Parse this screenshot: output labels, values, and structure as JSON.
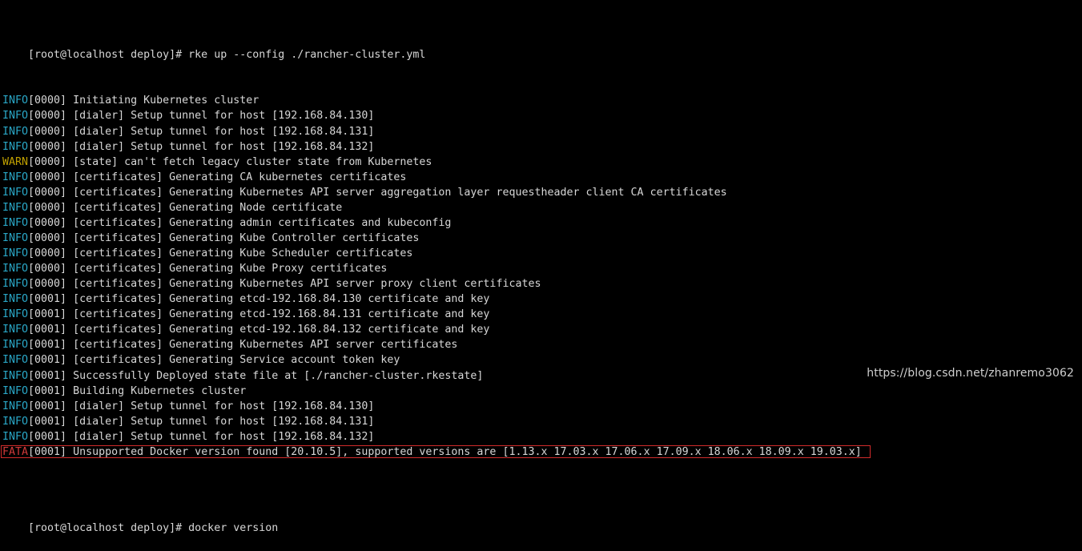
{
  "terminal": {
    "prompt_line": "[root@localhost deploy]# rke up --config ./rancher-cluster.yml",
    "log_lines": [
      {
        "level": "INFO",
        "code": "[0000]",
        "message": " Initiating Kubernetes cluster"
      },
      {
        "level": "INFO",
        "code": "[0000]",
        "message": " [dialer] Setup tunnel for host [192.168.84.130]"
      },
      {
        "level": "INFO",
        "code": "[0000]",
        "message": " [dialer] Setup tunnel for host [192.168.84.131]"
      },
      {
        "level": "INFO",
        "code": "[0000]",
        "message": " [dialer] Setup tunnel for host [192.168.84.132]"
      },
      {
        "level": "WARN",
        "code": "[0000]",
        "message": " [state] can't fetch legacy cluster state from Kubernetes"
      },
      {
        "level": "INFO",
        "code": "[0000]",
        "message": " [certificates] Generating CA kubernetes certificates"
      },
      {
        "level": "INFO",
        "code": "[0000]",
        "message": " [certificates] Generating Kubernetes API server aggregation layer requestheader client CA certificates"
      },
      {
        "level": "INFO",
        "code": "[0000]",
        "message": " [certificates] Generating Node certificate"
      },
      {
        "level": "INFO",
        "code": "[0000]",
        "message": " [certificates] Generating admin certificates and kubeconfig"
      },
      {
        "level": "INFO",
        "code": "[0000]",
        "message": " [certificates] Generating Kube Controller certificates"
      },
      {
        "level": "INFO",
        "code": "[0000]",
        "message": " [certificates] Generating Kube Scheduler certificates"
      },
      {
        "level": "INFO",
        "code": "[0000]",
        "message": " [certificates] Generating Kube Proxy certificates"
      },
      {
        "level": "INFO",
        "code": "[0000]",
        "message": " [certificates] Generating Kubernetes API server proxy client certificates"
      },
      {
        "level": "INFO",
        "code": "[0001]",
        "message": " [certificates] Generating etcd-192.168.84.130 certificate and key"
      },
      {
        "level": "INFO",
        "code": "[0001]",
        "message": " [certificates] Generating etcd-192.168.84.131 certificate and key"
      },
      {
        "level": "INFO",
        "code": "[0001]",
        "message": " [certificates] Generating etcd-192.168.84.132 certificate and key"
      },
      {
        "level": "INFO",
        "code": "[0001]",
        "message": " [certificates] Generating Kubernetes API server certificates"
      },
      {
        "level": "INFO",
        "code": "[0001]",
        "message": " [certificates] Generating Service account token key"
      },
      {
        "level": "INFO",
        "code": "[0001]",
        "message": " Successfully Deployed state file at [./rancher-cluster.rkestate]"
      },
      {
        "level": "INFO",
        "code": "[0001]",
        "message": " Building Kubernetes cluster"
      },
      {
        "level": "INFO",
        "code": "[0001]",
        "message": " [dialer] Setup tunnel for host [192.168.84.130]"
      },
      {
        "level": "INFO",
        "code": "[0001]",
        "message": " [dialer] Setup tunnel for host [192.168.84.131]"
      },
      {
        "level": "INFO",
        "code": "[0001]",
        "message": " [dialer] Setup tunnel for host [192.168.84.132]"
      },
      {
        "level": "FATA",
        "code": "[0001]",
        "message": " Unsupported Docker version found [20.10.5], supported versions are [1.13.x 17.03.x 17.06.x 17.09.x 18.06.x 18.09.x 19.03.x]",
        "highlighted": true
      }
    ],
    "trailing_prompt_line": "[root@localhost deploy]# docker version"
  },
  "watermark": "https://blog.csdn.net/zhanremo3062",
  "colors": {
    "background": "#000000",
    "text": "#d7d7d7",
    "info": "#2aa7c7",
    "warn": "#c0a000",
    "fata": "#d03a3a",
    "highlight_border": "#d12b2b"
  }
}
